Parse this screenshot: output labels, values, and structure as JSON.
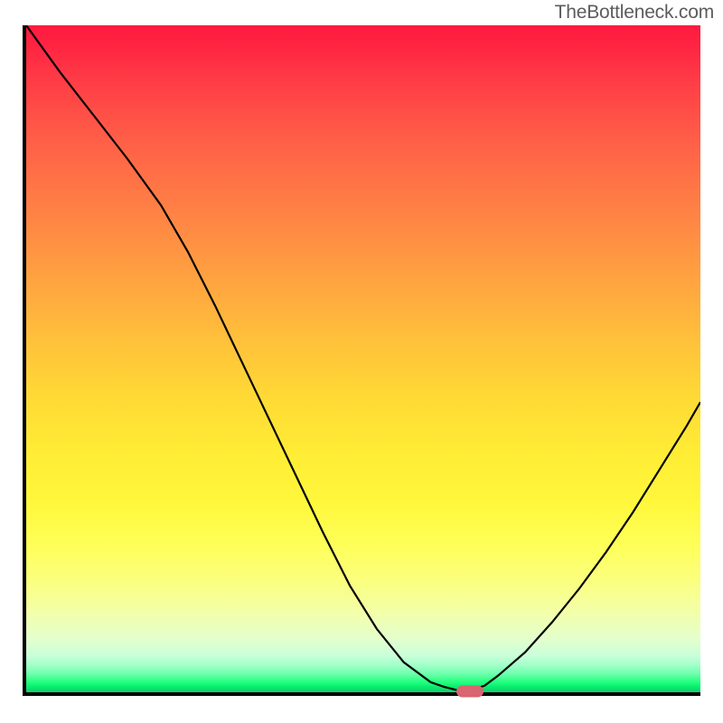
{
  "watermark": "TheBottleneck.com",
  "chart_data": {
    "type": "line",
    "title": "",
    "xlabel": "",
    "ylabel": "",
    "xlim": [
      0,
      100
    ],
    "ylim": [
      0,
      100
    ],
    "x": [
      0,
      5,
      10,
      15,
      20,
      24,
      28,
      32,
      36,
      40,
      44,
      48,
      52,
      56,
      60,
      62,
      64,
      66,
      68,
      70,
      74,
      78,
      82,
      86,
      90,
      94,
      98,
      100
    ],
    "y": [
      100,
      93,
      86.5,
      80,
      73,
      66,
      58,
      49.5,
      41,
      32.5,
      24,
      16,
      9.5,
      4.5,
      1.5,
      0.8,
      0.3,
      0.3,
      1.0,
      2.5,
      6,
      10.5,
      15.5,
      21,
      27,
      33.5,
      40,
      43.5
    ],
    "marker_position": {
      "x": 65.5,
      "y": 0.7
    },
    "background_gradient": {
      "top": "#ff1a3f",
      "mid": "#fff83d",
      "bottom": "#16c86d"
    }
  },
  "colors": {
    "axis": "#000000",
    "curve": "#000000",
    "marker": "#d96472",
    "watermark": "#5c5c5c"
  }
}
